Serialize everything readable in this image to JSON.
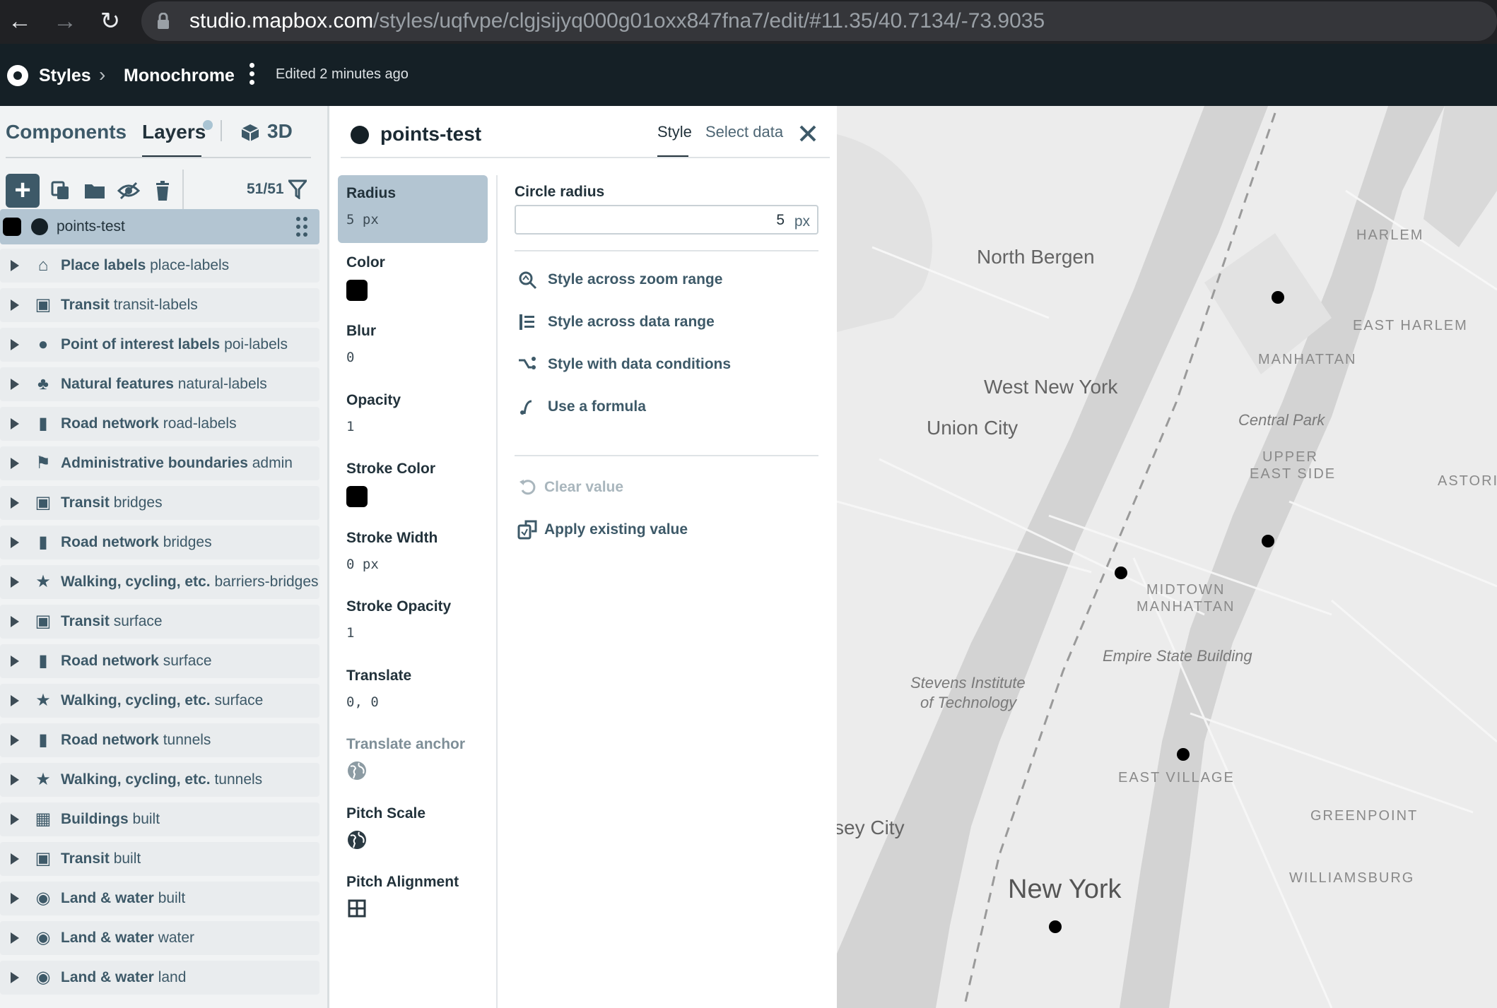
{
  "browser": {
    "url_host": "studio.mapbox.com",
    "url_path": "/styles/uqfvpe/clgjsijyq000g01oxx847fna7/edit/#11.35/40.7134/-73.9035",
    "back_icon": "arrow-left-icon",
    "forward_icon": "arrow-right-icon",
    "reload_icon": "reload-icon",
    "lock_icon": "lock-icon"
  },
  "header": {
    "logo_icon": "mapbox-logo-icon",
    "styles_label": "Styles",
    "style_name": "Monochrome",
    "edited": "Edited 2 minutes ago"
  },
  "left": {
    "tabs": {
      "components": "Components",
      "layers": "Layers",
      "three_d": "3D"
    },
    "layer_count": "51/51",
    "selected_layer": {
      "name": "points-test"
    },
    "layers": [
      {
        "name": "Place labels",
        "sub": "place-labels",
        "icon": "place-icon"
      },
      {
        "name": "Transit",
        "sub": "transit-labels",
        "icon": "transit-icon"
      },
      {
        "name": "Point of interest labels",
        "sub": "poi-labels",
        "icon": "pin-icon"
      },
      {
        "name": "Natural features",
        "sub": "natural-labels",
        "icon": "trees-icon"
      },
      {
        "name": "Road network",
        "sub": "road-labels",
        "icon": "road-icon"
      },
      {
        "name": "Administrative boundaries",
        "sub": "admin",
        "icon": "flag-icon"
      },
      {
        "name": "Transit",
        "sub": "bridges",
        "icon": "transit-icon"
      },
      {
        "name": "Road network",
        "sub": "bridges",
        "icon": "road-icon"
      },
      {
        "name": "Walking, cycling, etc.",
        "sub": "barriers-bridges",
        "icon": "walking-icon"
      },
      {
        "name": "Transit",
        "sub": "surface",
        "icon": "transit-icon"
      },
      {
        "name": "Road network",
        "sub": "surface",
        "icon": "road-icon"
      },
      {
        "name": "Walking, cycling, etc.",
        "sub": "surface",
        "icon": "walking-icon"
      },
      {
        "name": "Road network",
        "sub": "tunnels",
        "icon": "road-icon"
      },
      {
        "name": "Walking, cycling, etc.",
        "sub": "tunnels",
        "icon": "walking-icon"
      },
      {
        "name": "Buildings",
        "sub": "built",
        "icon": "building-icon"
      },
      {
        "name": "Transit",
        "sub": "built",
        "icon": "transit-icon"
      },
      {
        "name": "Land & water",
        "sub": "built",
        "icon": "globe-icon"
      },
      {
        "name": "Land & water",
        "sub": "water",
        "icon": "globe-icon"
      },
      {
        "name": "Land & water",
        "sub": "land",
        "icon": "globe-icon"
      }
    ]
  },
  "mid": {
    "title": "points-test",
    "tab_style": "Style",
    "tab_select": "Select data",
    "props": [
      {
        "name": "Radius",
        "value": "5 px",
        "kind": "text",
        "active": true
      },
      {
        "name": "Color",
        "value": "",
        "kind": "swatch",
        "color": "#000000"
      },
      {
        "name": "Blur",
        "value": "0",
        "kind": "text"
      },
      {
        "name": "Opacity",
        "value": "1",
        "kind": "text"
      },
      {
        "name": "Stroke Color",
        "value": "",
        "kind": "swatch",
        "color": "#000000"
      },
      {
        "name": "Stroke Width",
        "value": "0 px",
        "kind": "text"
      },
      {
        "name": "Stroke Opacity",
        "value": "1",
        "kind": "text"
      },
      {
        "name": "Translate",
        "value": "0, 0",
        "kind": "text"
      },
      {
        "name": "Translate anchor",
        "value": "",
        "kind": "globe",
        "muted": true
      },
      {
        "name": "Pitch Scale",
        "value": "",
        "kind": "globe"
      },
      {
        "name": "Pitch Alignment",
        "value": "",
        "kind": "grid"
      }
    ],
    "editor": {
      "label": "Circle radius",
      "value": "5",
      "unit": "px",
      "options": [
        {
          "label": "Style across zoom range",
          "icon": "zoom-range-icon"
        },
        {
          "label": "Style across data range",
          "icon": "data-range-icon"
        },
        {
          "label": "Style with data conditions",
          "icon": "conditions-icon"
        },
        {
          "label": "Use a formula",
          "icon": "formula-icon"
        }
      ],
      "clear": "Clear value",
      "apply": "Apply existing value"
    }
  },
  "map": {
    "labels": {
      "north_bergen": "North Bergen",
      "west_new_york": "West New York",
      "union_city": "Union City",
      "harlem": "HARLEM",
      "east_harlem": "EAST HARLEM",
      "manhattan": "MANHATTAN",
      "central_park": "Central Park",
      "upper_east_side_1": "UPPER",
      "upper_east_side_2": "EAST SIDE",
      "astoria": "ASTORIA",
      "midtown_1": "MIDTOWN",
      "midtown_2": "MANHATTAN",
      "empire": "Empire State Building",
      "stevens_1": "Stevens Institute",
      "stevens_2": "of Technology",
      "east_village": "EAST VILLAGE",
      "greenpoint": "GREENPOINT",
      "williamsburg": "WILLIAMSBURG",
      "jersey_city": "sey City",
      "new_york": "New York"
    },
    "colors": {
      "land": "#ececec",
      "water": "#d4d4d4",
      "point": "#000000"
    }
  }
}
